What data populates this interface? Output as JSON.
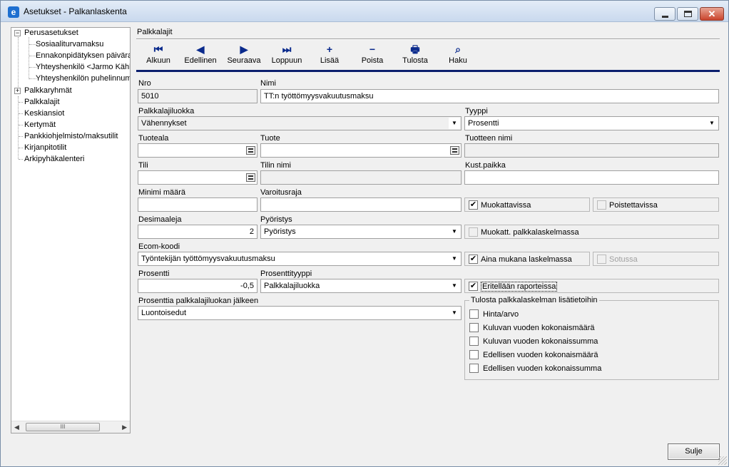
{
  "window": {
    "title": "Asetukset - Palkanlaskenta",
    "icon": "app-e-icon"
  },
  "tree": {
    "items": [
      {
        "label": "Perusasetukset",
        "expander": "−"
      },
      {
        "label": "Sosiaaliturvamaksu"
      },
      {
        "label": "Ennakonpidätyksen päivära"
      },
      {
        "label": "Yhteyshenkilö <Jarmo Kähk"
      },
      {
        "label": "Yhteyshenkilön puhelinnum"
      },
      {
        "label": "Palkkaryhmät",
        "expander": "+"
      },
      {
        "label": "Palkkalajit"
      },
      {
        "label": "Keskiansiot"
      },
      {
        "label": "Kertymät"
      },
      {
        "label": "Pankkiohjelmisto/maksutilit"
      },
      {
        "label": "Kirjanpitotilit"
      },
      {
        "label": "Arkipyhäkalenteri"
      }
    ],
    "scroll_thumb": "III"
  },
  "section_label": "Palkkalajit",
  "toolbar": [
    {
      "label": "Alkuun",
      "icon": "first-icon",
      "glyph": "⏮"
    },
    {
      "label": "Edellinen",
      "icon": "previous-icon",
      "glyph": "◀"
    },
    {
      "label": "Seuraava",
      "icon": "next-icon",
      "glyph": "▶"
    },
    {
      "label": "Loppuun",
      "icon": "last-icon",
      "glyph": "⏭"
    },
    {
      "label": "Lisää",
      "icon": "add-icon",
      "glyph": "+"
    },
    {
      "label": "Poista",
      "icon": "delete-icon",
      "glyph": "−"
    },
    {
      "label": "Tulosta",
      "icon": "printer-icon",
      "glyph": "🖶"
    },
    {
      "label": "Haku",
      "icon": "flashlight-icon",
      "glyph": "⌕"
    }
  ],
  "form": {
    "nro": {
      "label": "Nro",
      "value": "5010"
    },
    "nimi": {
      "label": "Nimi",
      "value": "TT:n työttömyysvakuutusmaksu"
    },
    "palkkalajiluokka": {
      "label": "Palkkalajiluokka",
      "value": "Vähennykset"
    },
    "tyyppi": {
      "label": "Tyyppi",
      "value": "Prosentti"
    },
    "tuoteala": {
      "label": "Tuoteala",
      "value": ""
    },
    "tuote": {
      "label": "Tuote",
      "value": ""
    },
    "tuotteen_nimi": {
      "label": "Tuotteen nimi",
      "value": ""
    },
    "tili": {
      "label": "Tili",
      "value": ""
    },
    "tilin_nimi": {
      "label": "Tilin nimi",
      "value": ""
    },
    "kustpaikka": {
      "label": "Kust.paikka",
      "value": ""
    },
    "minimi": {
      "label": "Minimi määrä",
      "value": ""
    },
    "varoitusraja": {
      "label": "Varoitusraja",
      "value": ""
    },
    "desimaaleja": {
      "label": "Desimaaleja",
      "value": "2"
    },
    "pyoristys": {
      "label": "Pyöristys",
      "value": "Pyöristys"
    },
    "ecom": {
      "label": "Ecom-koodi",
      "value": "Työntekijän työttömyysvakuutusmaksu"
    },
    "prosentti": {
      "label": "Prosentti",
      "value": "-0,5"
    },
    "prosenttityyppi": {
      "label": "Prosenttityyppi",
      "value": "Palkkalajiluokka"
    },
    "prosenttia_jalkeen": {
      "label": "Prosenttia palkkalajiluokan jälkeen",
      "value": "Luontoisedut"
    }
  },
  "checks": {
    "muokattavissa": {
      "label": "Muokattavissa",
      "checked": true,
      "mark": "✔"
    },
    "poistettavissa": {
      "label": "Poistettavissa",
      "checked": false
    },
    "muokatt_laskelmassa": {
      "label": "Muokatt. palkkalaskelmassa",
      "checked": false
    },
    "aina_mukana": {
      "label": "Aina mukana laskelmassa",
      "checked": true,
      "mark": "✔"
    },
    "sotussa": {
      "label": "Sotussa",
      "checked": false
    },
    "eritellaan": {
      "label": "Eritellään raporteissa",
      "checked": true,
      "mark": "✔"
    }
  },
  "lisatiedot": {
    "title": "Tulosta palkkalaskelman lisätietoihin",
    "items": [
      {
        "label": "Hinta/arvo",
        "checked": false
      },
      {
        "label": "Kuluvan vuoden kokonaismäärä",
        "checked": false
      },
      {
        "label": "Kuluvan vuoden kokonaissumma",
        "checked": false
      },
      {
        "label": "Edellisen vuoden kokonaismäärä",
        "checked": false
      },
      {
        "label": "Edellisen vuoden kokonaissumma",
        "checked": false
      }
    ]
  },
  "buttons": {
    "sulje": "Sulje"
  }
}
